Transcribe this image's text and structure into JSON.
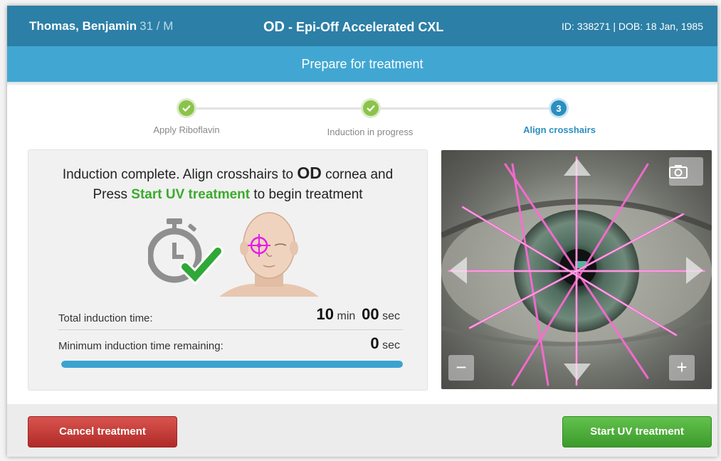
{
  "header": {
    "patient_name": "Thomas, Benjamin",
    "patient_age_sex": "31 / M",
    "eye": "OD",
    "procedure": " - Epi-Off Accelerated CXL",
    "id_dob": "ID: 338271 | DOB: 18 Jan, 1985"
  },
  "subheader": {
    "title": "Prepare for treatment"
  },
  "stepper": {
    "steps": [
      {
        "label": "Apply Riboflavin",
        "state": "done"
      },
      {
        "label": "Induction in progress",
        "state": "done"
      },
      {
        "label": "Align crosshairs",
        "state": "active",
        "number": "3"
      }
    ]
  },
  "instructions": {
    "line1_prefix": "Induction complete. Align crosshairs to ",
    "line1_eye": "OD",
    "line1_suffix": " cornea and",
    "line2_prefix": "Press ",
    "line2_highlight": "Start UV treatment",
    "line2_suffix": " to begin treatment"
  },
  "induction": {
    "total_label": "Total induction time:",
    "total_min": "10",
    "min_unit": "min",
    "total_sec": "00",
    "sec_unit": "sec",
    "remaining_label": "Minimum induction time remaining:",
    "remaining_sec": "0",
    "progress_fraction": 1.0
  },
  "camera": {
    "controls": [
      "arrow-up-icon",
      "arrow-down-icon",
      "arrow-left-icon",
      "arrow-right-icon",
      "camera-icon",
      "zoom-out-icon",
      "zoom-in-icon"
    ],
    "zoom_out_label": "−",
    "zoom_in_label": "+"
  },
  "footer": {
    "cancel_label": "Cancel treatment",
    "start_label": "Start UV treatment"
  },
  "colors": {
    "header": "#2c7fa6",
    "subheader": "#41a7d2",
    "accent_green": "#3caa2d",
    "cancel": "#c9302c",
    "start": "#4cae3a"
  }
}
